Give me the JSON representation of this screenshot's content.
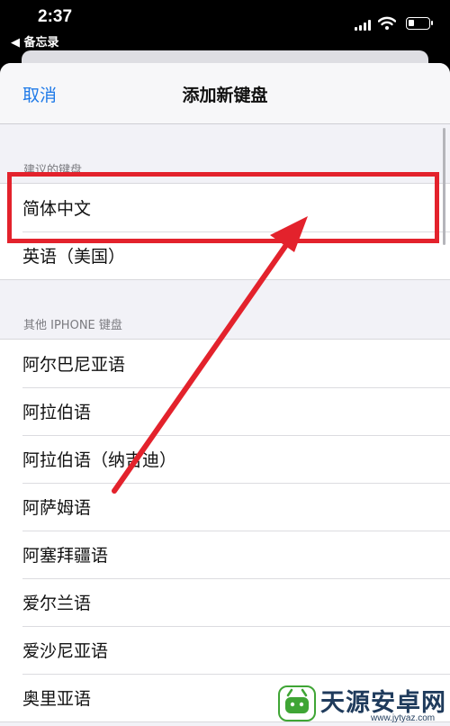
{
  "status_bar": {
    "time": "2:37",
    "back_app": "◀ 备忘录",
    "battery_level": 0.3
  },
  "nav": {
    "cancel_label": "取消",
    "title": "添加新键盘"
  },
  "suggested": {
    "header": "建议的键盘",
    "items": [
      {
        "label": "简体中文"
      },
      {
        "label": "英语（美国）"
      }
    ]
  },
  "other": {
    "header": "其他 IPHONE 键盘",
    "items": [
      {
        "label": "阿尔巴尼亚语"
      },
      {
        "label": "阿拉伯语"
      },
      {
        "label": "阿拉伯语（纳吉迪）"
      },
      {
        "label": "阿萨姆语"
      },
      {
        "label": "阿塞拜疆语"
      },
      {
        "label": "爱尔兰语"
      },
      {
        "label": "爱沙尼亚语"
      },
      {
        "label": "奥里亚语"
      }
    ]
  },
  "watermark": {
    "title": "天源安卓网",
    "url": "www.jytyaz.com"
  },
  "colors": {
    "accent": "#1f7ae8",
    "annotation": "#e3222c"
  }
}
